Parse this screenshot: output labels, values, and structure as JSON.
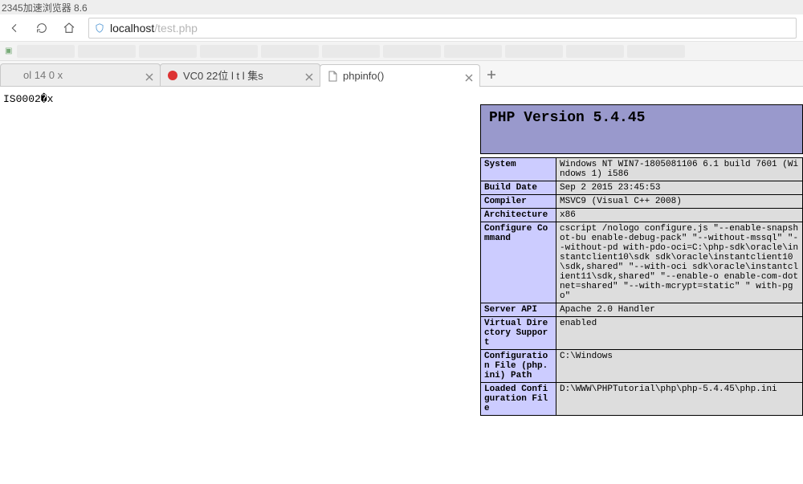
{
  "window": {
    "title": "2345加速浏览器 8.6"
  },
  "nav": {
    "url_domain": "localhost",
    "url_path": "/test.php"
  },
  "tabs": [
    {
      "label": "ol            14 0   x",
      "active": false,
      "icon": "blank"
    },
    {
      "label": "VC0 22位  l   t  l 集s",
      "active": false,
      "icon": "red"
    },
    {
      "label": "phpinfo()",
      "active": true,
      "icon": "page"
    }
  ],
  "page": {
    "body_text": "IS0002�x",
    "php_version_label": "PHP Version 5.4.45",
    "rows": [
      {
        "k": "System",
        "v": "Windows NT WIN7-1805081106 6.1 build 7601 (Windows 1) i586"
      },
      {
        "k": "Build Date",
        "v": "Sep 2 2015 23:45:53"
      },
      {
        "k": "Compiler",
        "v": "MSVC9 (Visual C++ 2008)"
      },
      {
        "k": "Architecture",
        "v": "x86"
      },
      {
        "k": "Configure Command",
        "v": "cscript /nologo configure.js \"--enable-snapshot-bu enable-debug-pack\" \"--without-mssql\" \"--without-pd with-pdo-oci=C:\\php-sdk\\oracle\\instantclient10\\sdk sdk\\oracle\\instantclient10\\sdk,shared\" \"--with-oci sdk\\oracle\\instantclient11\\sdk,shared\" \"--enable-o enable-com-dotnet=shared\" \"--with-mcrypt=static\" \" with-pgo\""
      },
      {
        "k": "Server API",
        "v": "Apache 2.0 Handler"
      },
      {
        "k": "Virtual Directory Support",
        "v": "enabled"
      },
      {
        "k": "Configuration File (php.ini) Path",
        "v": "C:\\Windows"
      },
      {
        "k": "Loaded Configuration File",
        "v": "D:\\WWW\\PHPTutorial\\php\\php-5.4.45\\php.ini"
      }
    ]
  }
}
